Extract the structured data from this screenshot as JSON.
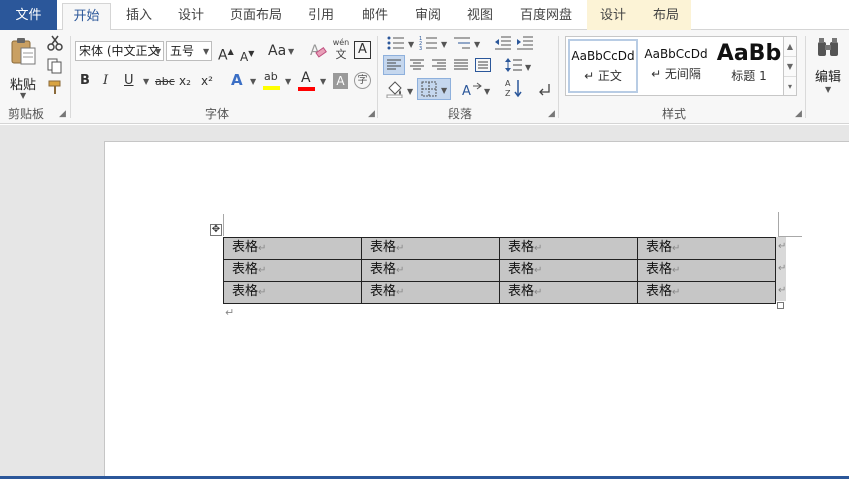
{
  "tabs": [
    "文件",
    "开始",
    "插入",
    "设计",
    "页面布局",
    "引用",
    "邮件",
    "审阅",
    "视图",
    "百度网盘"
  ],
  "context_tabs": [
    "设计",
    "布局"
  ],
  "active_tab": "开始",
  "clipboard": {
    "paste_label": "粘贴",
    "group_label": "剪贴板"
  },
  "font": {
    "name": "宋体 (中文正文",
    "size": "五号",
    "grow": "A",
    "shrink": "A",
    "change_case": "Aa",
    "phonetic_top": "wén",
    "phonetic_bottom": "文",
    "border_char": "A",
    "bold": "B",
    "italic": "I",
    "underline": "U",
    "strike": "abc",
    "subscript": "x₂",
    "superscript": "x²",
    "effects": "A",
    "highlight": "ab",
    "color": "A",
    "shade_char": "A",
    "enclose_char": "字",
    "group_label": "字体"
  },
  "paragraph": {
    "group_label": "段落"
  },
  "styles": {
    "items": [
      {
        "preview": "AaBbCcDd",
        "name": "↵ 正文"
      },
      {
        "preview": "AaBbCcDd",
        "name": "↵ 无间隔"
      },
      {
        "preview": "AaBb",
        "name": "标题 1"
      }
    ],
    "group_label": "样式"
  },
  "editing": {
    "label": "编辑"
  },
  "table": {
    "rows": [
      [
        "表格",
        "表格",
        "表格",
        "表格"
      ],
      [
        "表格",
        "表格",
        "表格",
        "表格"
      ],
      [
        "表格",
        "表格",
        "表格",
        "表格"
      ]
    ]
  },
  "colors": {
    "accent": "#2b579a",
    "highlight": "#ffff00",
    "font_color": "#ff0000",
    "cell_shading": "#c6c6c6"
  }
}
